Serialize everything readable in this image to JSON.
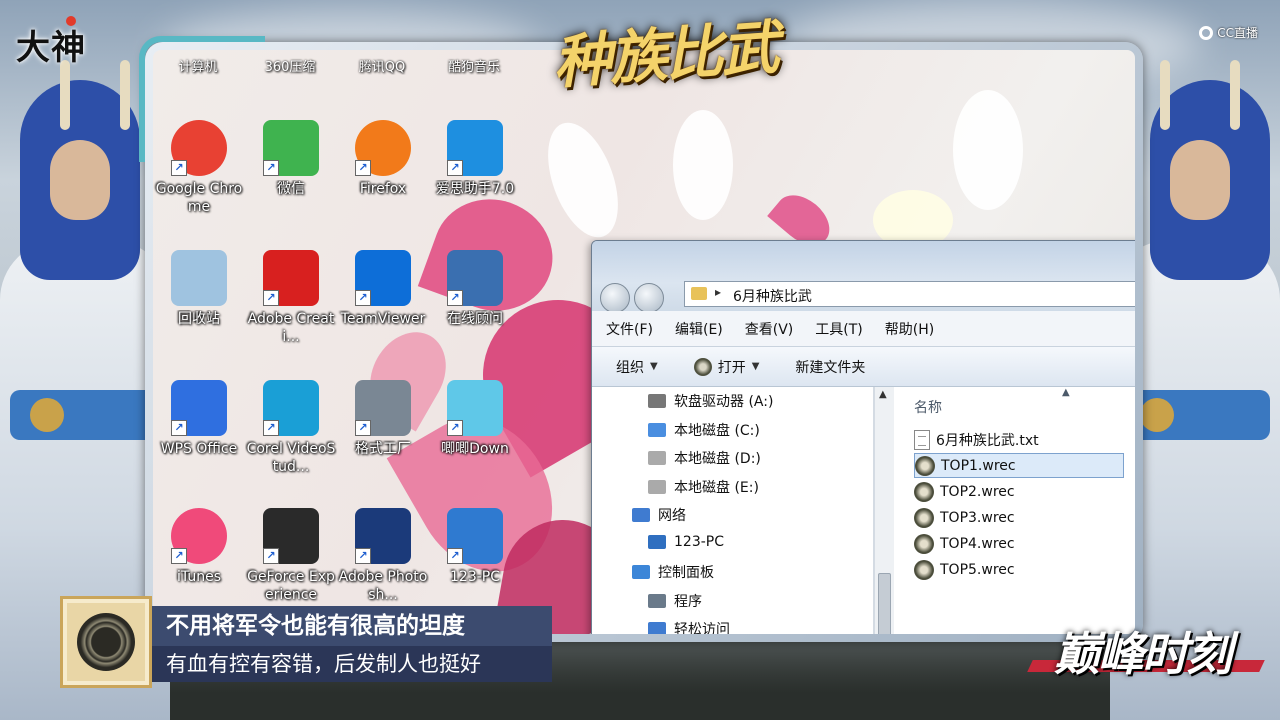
{
  "stream": {
    "logo_text": "大神",
    "cc_label": "CC直播",
    "event_title": "种族比武",
    "peak_tag": "巅峰时刻"
  },
  "caption": {
    "line1": "不用将军令也能有很高的坦度",
    "line2": "有血有控有容错，后发制人也挺好"
  },
  "desktop": {
    "top_row_labels": [
      "计算机",
      "360压缩",
      "腾讯QQ",
      "酷狗音乐"
    ],
    "icons": [
      {
        "label": "Google Chrome",
        "icon": "chrome-icon",
        "color": "#e84133"
      },
      {
        "label": "微信",
        "icon": "wechat-icon",
        "color": "#3fb34f"
      },
      {
        "label": "Firefox",
        "icon": "firefox-icon",
        "color": "#f27a1a"
      },
      {
        "label": "爱思助手7.0",
        "icon": "i4-icon",
        "color": "#1e8fe0"
      },
      {
        "label": "回收站",
        "icon": "recycle-bin-icon",
        "color": "#9fc3e0"
      },
      {
        "label": "Adobe Creati...",
        "icon": "adobe-cc-icon",
        "color": "#d8201f"
      },
      {
        "label": "TeamViewer",
        "icon": "teamviewer-icon",
        "color": "#0d6ed8"
      },
      {
        "label": "在线顾问",
        "icon": "consultant-icon",
        "color": "#3a6fb0"
      },
      {
        "label": "WPS Office",
        "icon": "wps-icon",
        "color": "#2f6fe0"
      },
      {
        "label": "Corel VideoStud...",
        "icon": "corel-icon",
        "color": "#1a9fd6"
      },
      {
        "label": "格式工厂",
        "icon": "format-factory-icon",
        "color": "#7a8794"
      },
      {
        "label": "唧唧Down",
        "icon": "jijidown-icon",
        "color": "#5fc8e8"
      },
      {
        "label": "iTunes",
        "icon": "itunes-icon",
        "color": "#f04a7a"
      },
      {
        "label": "GeForce Experience",
        "icon": "geforce-icon",
        "color": "#2a2a2a"
      },
      {
        "label": "Adobe Photosh...",
        "icon": "photoshop-icon",
        "color": "#1b3a7a"
      },
      {
        "label": "123-PC",
        "icon": "computer-icon",
        "color": "#2f7ad0"
      }
    ]
  },
  "explorer": {
    "address_path": "6月种族比武",
    "menu": [
      "文件(F)",
      "编辑(E)",
      "查看(V)",
      "工具(T)",
      "帮助(H)"
    ],
    "toolbar": {
      "organize": "组织",
      "open": "打开",
      "new_folder": "新建文件夹"
    },
    "nav_items": [
      {
        "label": "软盘驱动器 (A:)",
        "icon": "floppy-drive-icon"
      },
      {
        "label": "本地磁盘 (C:)",
        "icon": "windows-drive-icon"
      },
      {
        "label": "本地磁盘 (D:)",
        "icon": "drive-icon"
      },
      {
        "label": "本地磁盘 (E:)",
        "icon": "drive-icon"
      },
      {
        "label": "网络",
        "icon": "network-icon"
      },
      {
        "label": "123-PC",
        "icon": "computer-icon"
      },
      {
        "label": "控制面板",
        "icon": "control-panel-icon"
      },
      {
        "label": "程序",
        "icon": "programs-icon"
      },
      {
        "label": "轻松访问",
        "icon": "ease-of-access-icon"
      }
    ],
    "column_header": "名称",
    "files": [
      {
        "name": "6月种族比武.txt",
        "type": "txt",
        "selected": false
      },
      {
        "name": "TOP1.wrec",
        "type": "wrec",
        "selected": true
      },
      {
        "name": "TOP2.wrec",
        "type": "wrec",
        "selected": false
      },
      {
        "name": "TOP3.wrec",
        "type": "wrec",
        "selected": false
      },
      {
        "name": "TOP4.wrec",
        "type": "wrec",
        "selected": false
      },
      {
        "name": "TOP5.wrec",
        "type": "wrec",
        "selected": false
      }
    ]
  }
}
